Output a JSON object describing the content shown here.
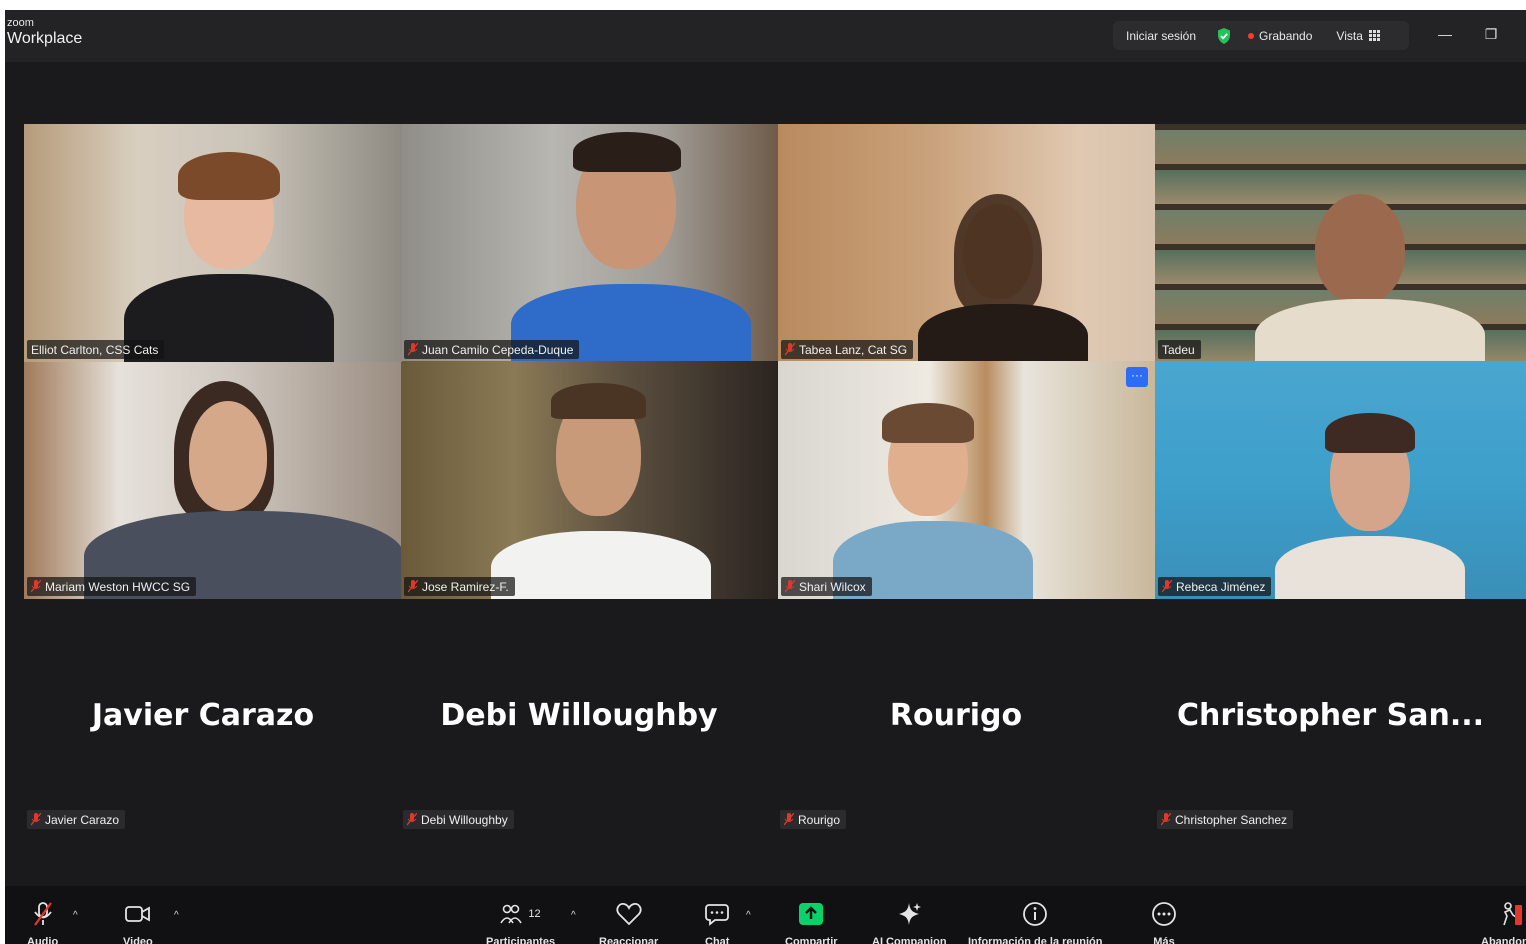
{
  "app": {
    "brand_small": "zoom",
    "brand_big": "Workplace"
  },
  "topbar": {
    "signin_label": "Iniciar sesión",
    "recording_label": "Grabando",
    "view_label": "Vista",
    "minimize_glyph": "—",
    "restore_glyph": "❐"
  },
  "tiles": [
    {
      "name": "Elliot Carlton, CSS Cats",
      "speaking": true,
      "muted": false
    },
    {
      "name": "Juan Camilo Cepeda-Duque",
      "speaking": false,
      "muted": true
    },
    {
      "name": "Tabea Lanz, Cat SG",
      "speaking": false,
      "muted": true
    },
    {
      "name": "Tadeu",
      "speaking": false,
      "muted": false
    },
    {
      "name": "Mariam Weston HWCC SG",
      "speaking": false,
      "muted": true
    },
    {
      "name": "Jose Ramirez-F.",
      "speaking": false,
      "muted": true
    },
    {
      "name": "Shari Wilcox",
      "speaking": false,
      "muted": true
    },
    {
      "name": "Rebeca Jiménez",
      "speaking": false,
      "muted": true
    }
  ],
  "more_button_glyph": "···",
  "audio_tiles": [
    {
      "display": "Javier Carazo",
      "tag": "Javier Carazo"
    },
    {
      "display": "Debi Willoughby",
      "tag": "Debi Willoughby"
    },
    {
      "display": "Rourigo",
      "tag": "Rourigo"
    },
    {
      "display": "Christopher  San...",
      "tag": "Christopher Sanchez"
    }
  ],
  "toolbar": {
    "audio": "Audio",
    "video": "Video",
    "participants": "Participantes",
    "participants_count": "12",
    "react": "Reaccionar",
    "chat": "Chat",
    "share": "Compartir",
    "ai": "AI Companion",
    "info": "Información de la reunión",
    "more": "Más",
    "leave": "Abandonar",
    "caret": "^"
  },
  "colors": {
    "speaking_border": "#23d160",
    "share_green": "#0bd16a",
    "recording_dot": "#ff3b30",
    "muted_red": "#e0392b",
    "more_blue": "#2d6cf6"
  }
}
